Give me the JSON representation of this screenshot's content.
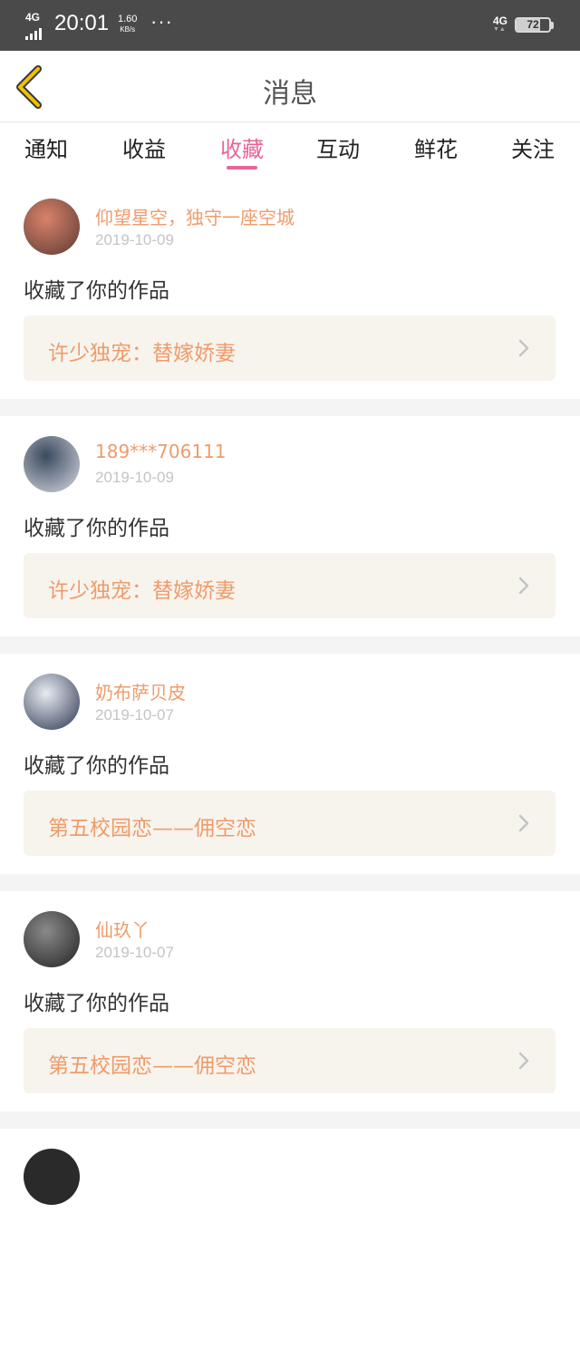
{
  "status_bar": {
    "network": "4G",
    "time": "20:01",
    "speed_value": "1.60",
    "speed_unit": "KB/s",
    "more": "···",
    "network_right": "4G",
    "battery": "72",
    "battery_level": 0.72
  },
  "nav": {
    "title": "消息",
    "back_icon": "chevron-left-icon",
    "accent_color": "#f2c200"
  },
  "tabs": [
    {
      "label": "通知",
      "active": false
    },
    {
      "label": "收益",
      "active": false
    },
    {
      "label": "收藏",
      "active": true
    },
    {
      "label": "互动",
      "active": false
    },
    {
      "label": "鲜花",
      "active": false
    },
    {
      "label": "关注",
      "active": false
    }
  ],
  "colors": {
    "tab_active": "#e8649a",
    "username": "#ef9b6a",
    "work_title": "#ef9b6a",
    "card_link_bg": "#f7f4ee"
  },
  "messages": [
    {
      "username": "仰望星空，独守一座空城",
      "date": "2019-10-09",
      "action": "收藏了你的作品",
      "work_title": "许少独宠：替嫁娇妻",
      "avatar_colors": [
        "#d9826a",
        "#5b3b33"
      ]
    },
    {
      "username": "189***706111",
      "date": "2019-10-09",
      "action": "收藏了你的作品",
      "work_title": "许少独宠：替嫁娇妻",
      "avatar_colors": [
        "#3a4a5e",
        "#d8d8e2"
      ]
    },
    {
      "username": "奶布萨贝皮",
      "date": "2019-10-07",
      "action": "收藏了你的作品",
      "work_title": "第五校园恋——佣空恋",
      "avatar_colors": [
        "#e8ecf2",
        "#2b3550"
      ]
    },
    {
      "username": "仙玖丫",
      "date": "2019-10-07",
      "action": "收藏了你的作品",
      "work_title": "第五校园恋——佣空恋",
      "avatar_colors": [
        "#8a8a8a",
        "#222222"
      ]
    }
  ]
}
